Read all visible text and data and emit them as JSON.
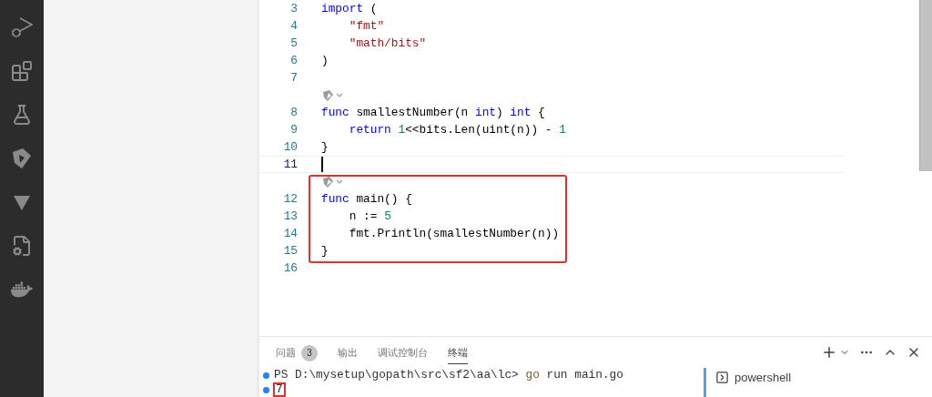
{
  "activity_bar": {
    "items": [
      {
        "kind": "debug",
        "selected": false
      },
      {
        "kind": "extensions",
        "selected": false
      },
      {
        "kind": "testing",
        "selected": false
      },
      {
        "kind": "lens",
        "selected": false
      },
      {
        "kind": "triangle",
        "selected": false
      },
      {
        "kind": "filecog",
        "selected": false
      },
      {
        "kind": "docker",
        "selected": false
      }
    ]
  },
  "editor": {
    "lines": [
      {
        "kind": "code",
        "number": "3",
        "tokens": [
          {
            "kind": "kw",
            "text": "import"
          },
          {
            "kind": "plain",
            "text": " ("
          }
        ]
      },
      {
        "kind": "code",
        "number": "4",
        "tokens": [
          {
            "kind": "str",
            "text": "    \"fmt\""
          }
        ]
      },
      {
        "kind": "code",
        "number": "5",
        "tokens": [
          {
            "kind": "str",
            "text": "    \"math/bits\""
          }
        ]
      },
      {
        "kind": "code",
        "number": "6",
        "tokens": [
          {
            "kind": "plain",
            "text": ")"
          }
        ]
      },
      {
        "kind": "code",
        "number": "7"
      },
      {
        "kind": "lens"
      },
      {
        "kind": "code",
        "number": "8",
        "tokens": [
          {
            "kind": "kw",
            "text": "func"
          },
          {
            "kind": "plain",
            "text": " smallestNumber(n "
          },
          {
            "kind": "kw",
            "text": "int"
          },
          {
            "kind": "plain",
            "text": ") "
          },
          {
            "kind": "kw",
            "text": "int"
          },
          {
            "kind": "plain",
            "text": " {"
          }
        ]
      },
      {
        "kind": "code",
        "number": "9",
        "tokens": [
          {
            "kind": "kw",
            "text": "    return "
          },
          {
            "kind": "num",
            "text": "1"
          },
          {
            "kind": "plain",
            "text": "<<bits.Len(uint(n)) - "
          },
          {
            "kind": "num",
            "text": "1"
          }
        ]
      },
      {
        "kind": "code",
        "number": "10",
        "tokens": [
          {
            "kind": "plain",
            "text": "}"
          }
        ]
      },
      {
        "kind": "code",
        "number": "11",
        "current": true
      },
      {
        "kind": "lens",
        "boxed": true
      },
      {
        "kind": "code",
        "number": "12",
        "boxed": true,
        "tokens": [
          {
            "kind": "kw",
            "text": "func"
          },
          {
            "kind": "plain",
            "text": " main() {"
          }
        ]
      },
      {
        "kind": "code",
        "number": "13",
        "boxed": true,
        "tokens": [
          {
            "kind": "plain",
            "text": "    n := "
          },
          {
            "kind": "num",
            "text": "5"
          }
        ]
      },
      {
        "kind": "code",
        "number": "14",
        "boxed": true,
        "tokens": [
          {
            "kind": "plain",
            "text": "    fmt.Println(smallestNumber(n))"
          }
        ]
      },
      {
        "kind": "code",
        "number": "15",
        "boxed": true,
        "tokens": [
          {
            "kind": "plain",
            "text": "}"
          }
        ]
      },
      {
        "kind": "code",
        "number": "16"
      }
    ]
  },
  "panel": {
    "tabs": [
      {
        "label": "问题",
        "badge": "3",
        "selected": false
      },
      {
        "label": "输出",
        "selected": false
      },
      {
        "label": "调试控制台",
        "selected": false
      },
      {
        "label": "终端",
        "selected": true
      }
    ],
    "actions": [
      {
        "kind": "plus"
      },
      {
        "kind": "caret"
      },
      {
        "kind": "more"
      },
      {
        "kind": "up"
      },
      {
        "kind": "close"
      }
    ],
    "terminal": {
      "lines": [
        {
          "prompt": "PS D:\\mysetup\\gopath\\src\\sf2\\aa\\lc> ",
          "command": "go",
          "args": " run main.go",
          "boxed": false
        },
        {
          "output": "7",
          "boxed": true
        }
      ]
    },
    "terminal_list": [
      {
        "label": "powershell",
        "selected": false
      }
    ]
  }
}
